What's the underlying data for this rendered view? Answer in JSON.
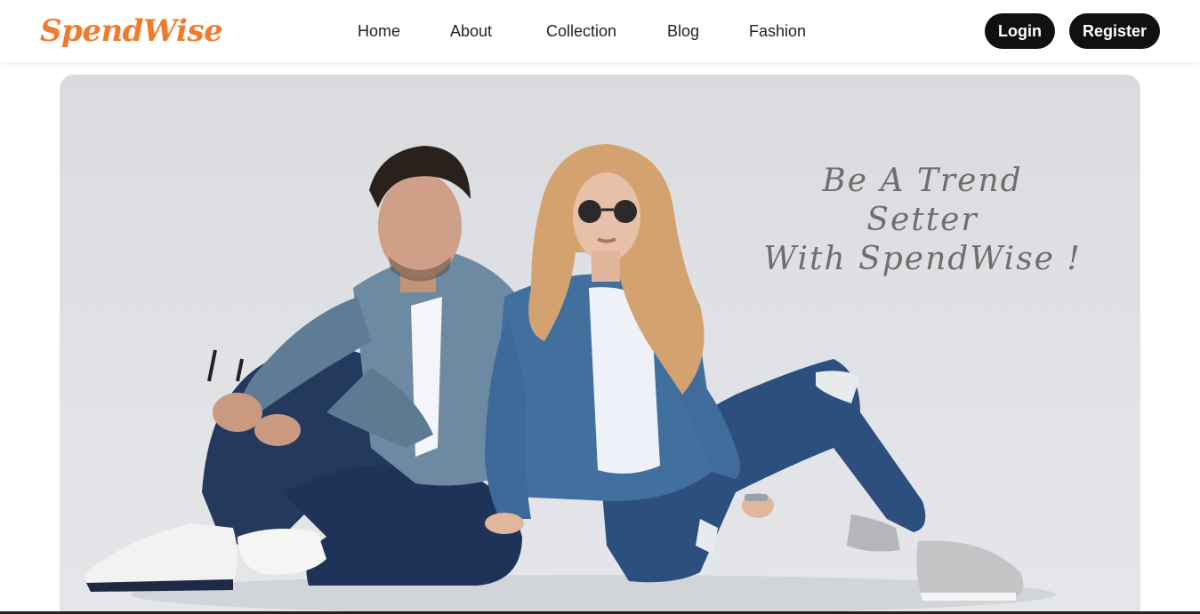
{
  "brand": {
    "name": "SpendWise",
    "color": "#f07b2c"
  },
  "nav": {
    "links": [
      "Home",
      "About",
      "Collection",
      "Blog",
      "Fashion"
    ],
    "login_label": "Login",
    "register_label": "Register"
  },
  "hero": {
    "tagline_line1": "Be A Trend Setter",
    "tagline_line2": "With SpendWise !",
    "image": "fashion-models-photo"
  },
  "colors": {
    "button_bg": "#111111",
    "hero_bg": "#dcdee1"
  }
}
